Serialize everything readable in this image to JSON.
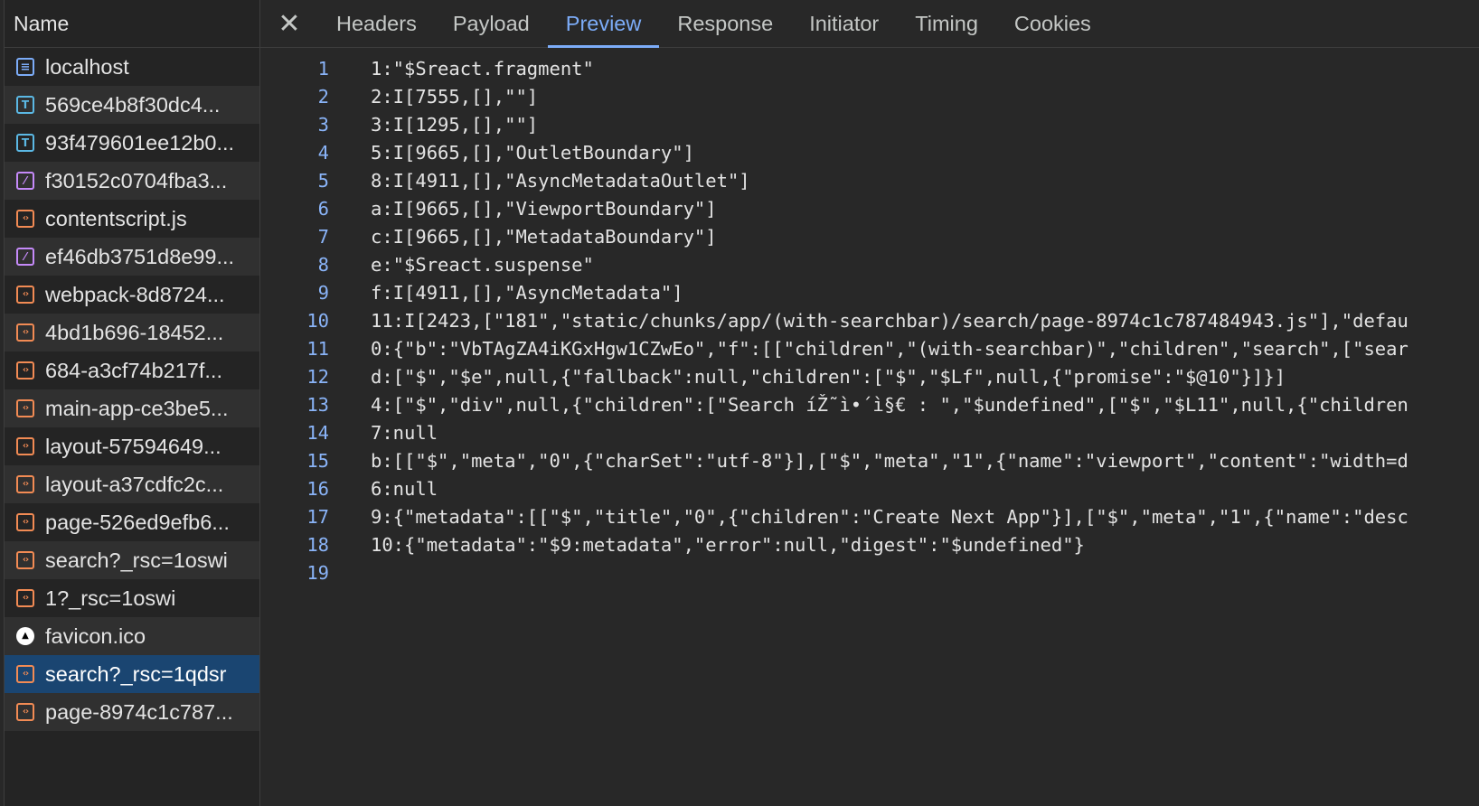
{
  "sidebar": {
    "header": "Name",
    "items": [
      {
        "label": "localhost",
        "icon": "document-icon",
        "glyph": "≡",
        "kind": "doc"
      },
      {
        "label": "569ce4b8f30dc4...",
        "icon": "font-icon",
        "glyph": "T",
        "kind": "font"
      },
      {
        "label": "93f479601ee12b0...",
        "icon": "font-icon",
        "glyph": "T",
        "kind": "font"
      },
      {
        "label": "f30152c0704fba3...",
        "icon": "image-icon",
        "glyph": "⁄",
        "kind": "img"
      },
      {
        "label": "contentscript.js",
        "icon": "script-icon",
        "glyph": "‹›",
        "kind": "script"
      },
      {
        "label": "ef46db3751d8e99...",
        "icon": "image-icon",
        "glyph": "⁄",
        "kind": "img"
      },
      {
        "label": "webpack-8d8724...",
        "icon": "script-icon",
        "glyph": "‹›",
        "kind": "script"
      },
      {
        "label": "4bd1b696-18452...",
        "icon": "script-icon",
        "glyph": "‹›",
        "kind": "script"
      },
      {
        "label": "684-a3cf74b217f...",
        "icon": "script-icon",
        "glyph": "‹›",
        "kind": "script"
      },
      {
        "label": "main-app-ce3be5...",
        "icon": "script-icon",
        "glyph": "‹›",
        "kind": "script"
      },
      {
        "label": "layout-57594649...",
        "icon": "script-icon",
        "glyph": "‹›",
        "kind": "script"
      },
      {
        "label": "layout-a37cdfc2c...",
        "icon": "script-icon",
        "glyph": "‹›",
        "kind": "script"
      },
      {
        "label": "page-526ed9efb6...",
        "icon": "script-icon",
        "glyph": "‹›",
        "kind": "script"
      },
      {
        "label": "search?_rsc=1oswi",
        "icon": "script-icon",
        "glyph": "‹›",
        "kind": "script"
      },
      {
        "label": "1?_rsc=1oswi",
        "icon": "script-icon",
        "glyph": "‹›",
        "kind": "script"
      },
      {
        "label": "favicon.ico",
        "icon": "vercel-triangle-icon",
        "glyph": "▲",
        "kind": "vercel"
      },
      {
        "label": "search?_rsc=1qdsr",
        "icon": "script-icon",
        "glyph": "‹›",
        "kind": "script",
        "selected": true
      },
      {
        "label": "page-8974c1c787...",
        "icon": "script-icon",
        "glyph": "‹›",
        "kind": "script"
      }
    ]
  },
  "tabs": {
    "close_glyph": "✕",
    "items": [
      "Headers",
      "Payload",
      "Preview",
      "Response",
      "Initiator",
      "Timing",
      "Cookies"
    ],
    "active": "Preview"
  },
  "preview": {
    "lines": [
      {
        "n": "1",
        "text": "1:\"$Sreact.fragment\""
      },
      {
        "n": "2",
        "text": "2:I[7555,[],\"\"]"
      },
      {
        "n": "3",
        "text": "3:I[1295,[],\"\"]"
      },
      {
        "n": "4",
        "text": "5:I[9665,[],\"OutletBoundary\"]"
      },
      {
        "n": "5",
        "text": "8:I[4911,[],\"AsyncMetadataOutlet\"]"
      },
      {
        "n": "6",
        "text": "a:I[9665,[],\"ViewportBoundary\"]"
      },
      {
        "n": "7",
        "text": "c:I[9665,[],\"MetadataBoundary\"]"
      },
      {
        "n": "8",
        "text": "e:\"$Sreact.suspense\""
      },
      {
        "n": "9",
        "text": "f:I[4911,[],\"AsyncMetadata\"]"
      },
      {
        "n": "10",
        "text": "11:I[2423,[\"181\",\"static/chunks/app/(with-searchbar)/search/page-8974c1c787484943.js\"],\"defau"
      },
      {
        "n": "11",
        "text": "0:{\"b\":\"VbTAgZA4iKGxHgw1CZwEo\",\"f\":[[\"children\",\"(with-searchbar)\",\"children\",\"search\",[\"sear"
      },
      {
        "n": "12",
        "text": "d:[\"$\",\"$e\",null,{\"fallback\":null,\"children\":[\"$\",\"$Lf\",null,{\"promise\":\"$@10\"}]}]"
      },
      {
        "n": "13",
        "text": "4:[\"$\",\"div\",null,{\"children\":[\"Search íŽ˜ì•´ì§€ : \",\"$undefined\",[\"$\",\"$L11\",null,{\"children"
      },
      {
        "n": "14",
        "text": "7:null"
      },
      {
        "n": "15",
        "text": "b:[[\"$\",\"meta\",\"0\",{\"charSet\":\"utf-8\"}],[\"$\",\"meta\",\"1\",{\"name\":\"viewport\",\"content\":\"width=d"
      },
      {
        "n": "16",
        "text": "6:null"
      },
      {
        "n": "17",
        "text": "9:{\"metadata\":[[\"$\",\"title\",\"0\",{\"children\":\"Create Next App\"}],[\"$\",\"meta\",\"1\",{\"name\":\"desc"
      },
      {
        "n": "18",
        "text": "10:{\"metadata\":\"$9:metadata\",\"error\":null,\"digest\":\"$undefined\"}"
      },
      {
        "n": "19",
        "text": ""
      }
    ]
  },
  "colors": {
    "selected_row": "#1a4571",
    "accent": "#7cacf8",
    "line_number": "#8ab4f8",
    "script_icon": "#f28b54",
    "font_icon": "#5bb8e4",
    "image_icon": "#c58af9"
  }
}
